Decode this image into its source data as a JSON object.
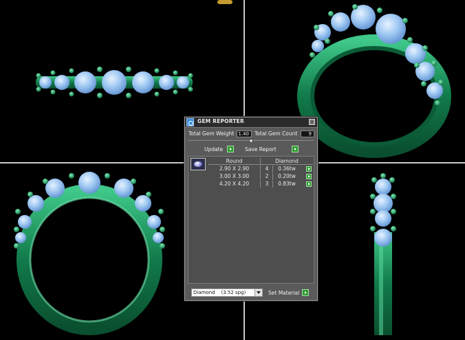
{
  "colors": {
    "background": "#000000",
    "metal": "#1f9d66",
    "metal_highlight": "#5fe0a4",
    "gem": "#9fc8f2",
    "panel": "#5a5a5a",
    "accent_button": "#2f9b2f"
  },
  "panel": {
    "title": "GEM REPORTER",
    "close_glyph": "x",
    "total_gem_weight_label": "Total Gem Weight",
    "total_gem_weight_value": "1.40",
    "total_gem_count_label": "Total Gem Count",
    "total_gem_count_value": "9",
    "update_label": "Update",
    "save_report_label": "Save Report",
    "columns": [
      "Round",
      "Diamond"
    ],
    "gems": [
      {
        "size": "2.90 X 2.90",
        "count": "4",
        "weight": "0.36tw"
      },
      {
        "size": "3.00 X 3.00",
        "count": "2",
        "weight": "0.20tw"
      },
      {
        "size": "4.20 X 4.20",
        "count": "3",
        "weight": "0.83tw"
      }
    ],
    "material_select": "Diamond    (3.52 spg)",
    "set_material_label": "Set Material"
  },
  "icons": [
    "app-icon",
    "close-icon",
    "update-arrow-icon",
    "save-arrow-icon",
    "gem-thumbnail-icon",
    "dropdown-arrow-icon",
    "set-material-arrow-icon"
  ]
}
